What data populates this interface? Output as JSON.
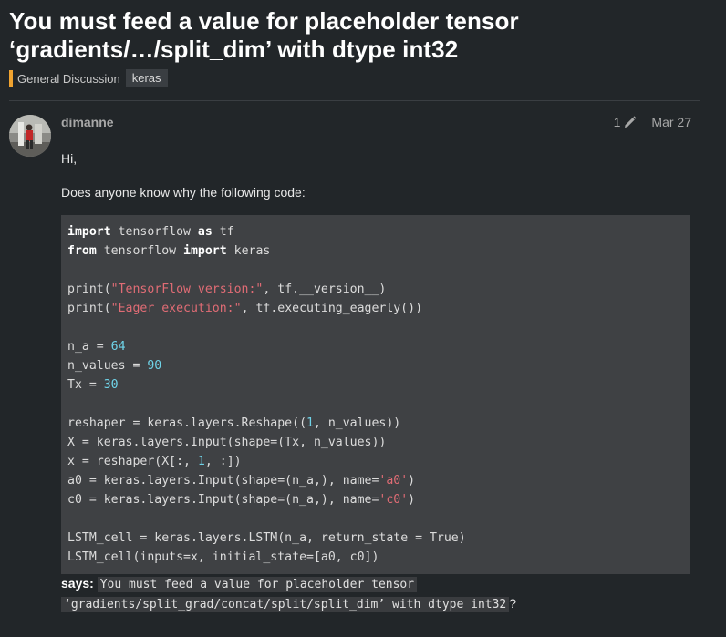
{
  "topic": {
    "title_line1": "You must feed a value for placeholder tensor",
    "title_line2": "‘gradients/…/split_dim’ with dtype int32",
    "category": "General Discussion",
    "tag": "keras",
    "category_color": "#f0a330"
  },
  "post": {
    "username": "dimanne",
    "edit_count": "1",
    "date": "Mar 27",
    "greeting": "Hi,",
    "question": "Does anyone know why the following code:",
    "says_label": "says:",
    "error_line1": "You must feed a value for placeholder tensor",
    "error_line2": "‘gradients/split_grad/concat/split/split_dim’ with dtype int32",
    "error_suffix": "?"
  },
  "code": {
    "l1_kw1": "import",
    "l1_a": " tensorflow ",
    "l1_kw2": "as",
    "l1_b": " tf",
    "l2_kw1": "from",
    "l2_a": " tensorflow ",
    "l2_kw2": "import",
    "l2_b": " keras",
    "l4_a": "print(",
    "l4_str": "\"TensorFlow version:\"",
    "l4_b": ", tf.__version__)",
    "l5_a": "print(",
    "l5_str": "\"Eager execution:\"",
    "l5_b": ", tf.executing_eagerly())",
    "l7_a": "n_a = ",
    "l7_num": "64",
    "l8_a": "n_values = ",
    "l8_num": "90",
    "l9_a": "Tx = ",
    "l9_num": "30",
    "l11_a": "reshaper = keras.layers.Reshape((",
    "l11_num": "1",
    "l11_b": ", n_values))",
    "l12": "X = keras.layers.Input(shape=(Tx, n_values))",
    "l13_a": "x = reshaper(X[:, ",
    "l13_num": "1",
    "l13_b": ", :])",
    "l14_a": "a0 = keras.layers.Input(shape=(n_a,), name=",
    "l14_str": "'a0'",
    "l14_b": ")",
    "l15_a": "c0 = keras.layers.Input(shape=(n_a,), name=",
    "l15_str": "'c0'",
    "l15_b": ")",
    "l17": "LSTM_cell = keras.layers.LSTM(n_a, return_state = True)",
    "l18": "LSTM_cell(inputs=x, initial_state=[a0, c0])"
  }
}
